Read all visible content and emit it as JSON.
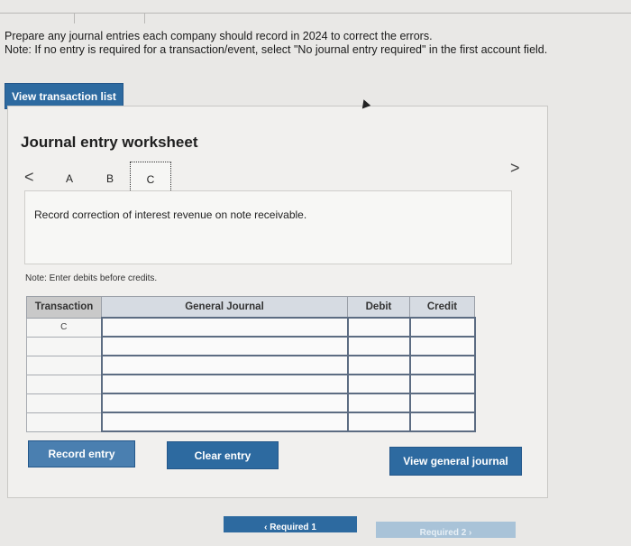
{
  "instructions": {
    "line1": "Prepare any journal entries each company should record in 2024 to correct the errors.",
    "line2": "Note: If no entry is required for a transaction/event, select \"No journal entry required\" in the first account field."
  },
  "buttons": {
    "view_transaction_list": "View transaction list",
    "record_entry": "Record entry",
    "clear_entry": "Clear entry",
    "view_general_journal": "View general journal",
    "required_prev": "‹  Required 1",
    "required_next": "Required 2  ›"
  },
  "worksheet": {
    "title": "Journal entry worksheet",
    "nav_prev": "<",
    "nav_next": ">",
    "tabs": [
      "A",
      "B",
      "C"
    ],
    "description": "Record correction of interest revenue on note receivable.",
    "note": "Note: Enter debits before credits."
  },
  "table": {
    "headers": [
      "Transaction",
      "General Journal",
      "Debit",
      "Credit"
    ],
    "rows": [
      [
        "C",
        "",
        "",
        ""
      ],
      [
        "",
        "",
        "",
        ""
      ],
      [
        "",
        "",
        "",
        ""
      ],
      [
        "",
        "",
        "",
        ""
      ],
      [
        "",
        "",
        "",
        ""
      ],
      [
        "",
        "",
        "",
        ""
      ]
    ]
  },
  "colors": {
    "button_blue": "#2d6aa0",
    "header_bg": "#d6dbe2",
    "disabled_button": "#a9c3d8"
  }
}
